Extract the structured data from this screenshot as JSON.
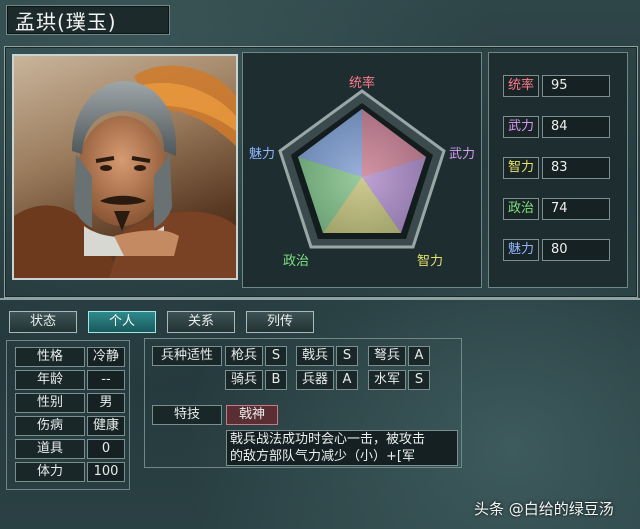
{
  "officer": {
    "name": "孟珙(璞玉)"
  },
  "radar": {
    "labels": {
      "top": "统率",
      "right": "武力",
      "bottom_right": "智力",
      "bottom_left": "政治",
      "left": "魅力"
    },
    "label_colors": {
      "top": "#ff7a8a",
      "right": "#d79af2",
      "bottom_right": "#e5e06a",
      "bottom_left": "#7fe07f",
      "left": "#8fb6ff"
    }
  },
  "stats": [
    {
      "name": "统率",
      "value": "95",
      "color": "#ff7a8a"
    },
    {
      "name": "武力",
      "value": "84",
      "color": "#d79af2"
    },
    {
      "name": "智力",
      "value": "83",
      "color": "#e5e06a"
    },
    {
      "name": "政治",
      "value": "74",
      "color": "#7fe07f"
    },
    {
      "name": "魅力",
      "value": "80",
      "color": "#8fb6ff"
    }
  ],
  "tabs": [
    "状态",
    "个人",
    "关系",
    "列传"
  ],
  "active_tab": "个人",
  "personal": [
    {
      "label": "性格",
      "value": "冷静"
    },
    {
      "label": "年龄",
      "value": "--"
    },
    {
      "label": "性别",
      "value": "男"
    },
    {
      "label": "伤病",
      "value": "健康"
    },
    {
      "label": "道具",
      "value": "0"
    },
    {
      "label": "体力",
      "value": "100"
    }
  ],
  "aptitude": {
    "header": "兵种适性",
    "units": [
      {
        "name": "枪兵",
        "rank": "S"
      },
      {
        "name": "戟兵",
        "rank": "S"
      },
      {
        "name": "弩兵",
        "rank": "A"
      },
      {
        "name": "骑兵",
        "rank": "B"
      },
      {
        "name": "兵器",
        "rank": "A"
      },
      {
        "name": "水军",
        "rank": "S"
      }
    ]
  },
  "skill": {
    "header": "特技",
    "name": "戟神",
    "description_line1": "戟兵战法成功时会心一击，被攻击",
    "description_line2": "的敌方部队气力减少（小）+[军"
  },
  "watermark": "头条 @白给的绿豆汤"
}
